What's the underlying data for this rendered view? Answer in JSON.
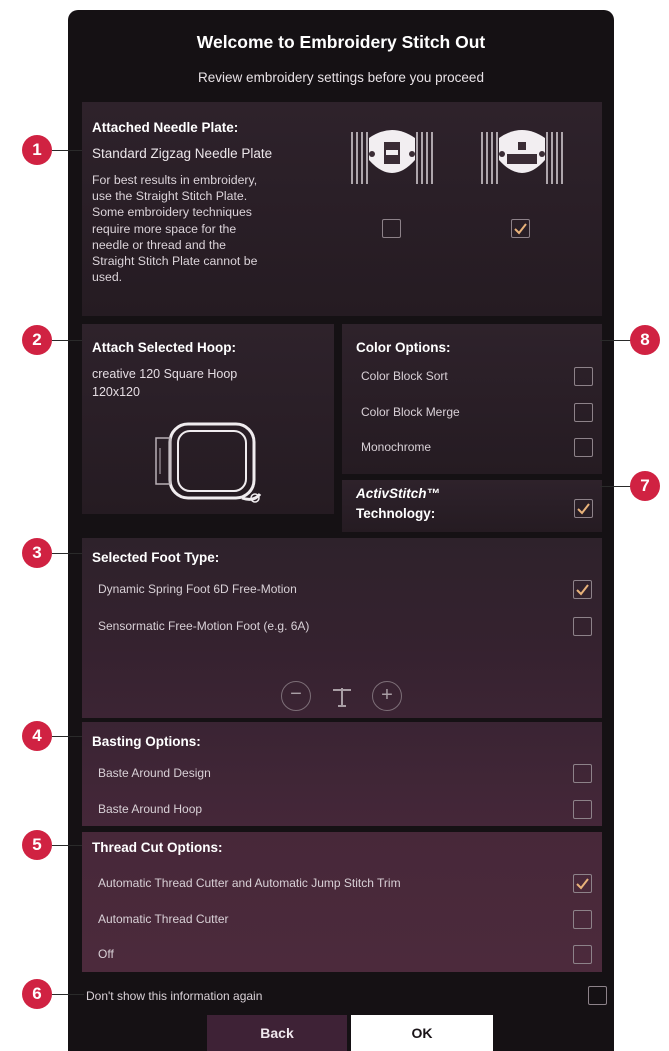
{
  "header": {
    "title": "Welcome to Embroidery Stitch Out",
    "subtitle": "Review embroidery settings before you proceed"
  },
  "needle_plate": {
    "title": "Attached Needle Plate:",
    "value": "Standard Zigzag Needle Plate",
    "desc_lines": [
      "For best results in embroidery,",
      "use the Straight Stitch Plate.",
      "Some embroidery techniques",
      "require more space for the",
      "needle or thread and the",
      "Straight Stitch Plate cannot be",
      "used."
    ],
    "plates": [
      {
        "icon": "zigzag-needle-plate-icon",
        "checked": false
      },
      {
        "icon": "straight-stitch-plate-icon",
        "checked": true
      }
    ]
  },
  "hoop": {
    "title": "Attach Selected Hoop:",
    "name_line1": "creative 120 Square Hoop",
    "name_line2": "120x120"
  },
  "color_options": {
    "title": "Color Options:",
    "items": [
      {
        "label": "Color Block Sort",
        "checked": false
      },
      {
        "label": "Color Block Merge",
        "checked": false
      },
      {
        "label": "Monochrome",
        "checked": false
      }
    ]
  },
  "activstitch": {
    "line1": "ActivStitch™",
    "line2": "Technology:",
    "checked": true
  },
  "foot": {
    "title": "Selected Foot Type:",
    "items": [
      {
        "label": "Dynamic Spring Foot 6D Free-Motion",
        "checked": true
      },
      {
        "label": "Sensormatic Free-Motion Foot (e.g. 6A)",
        "checked": false
      }
    ],
    "minus_symbol": "−",
    "plus_symbol": "+"
  },
  "basting": {
    "title": "Basting Options:",
    "items": [
      {
        "label": "Baste Around Design",
        "checked": false
      },
      {
        "label": "Baste Around Hoop",
        "checked": false
      }
    ]
  },
  "thread_cut": {
    "title": "Thread Cut Options:",
    "items": [
      {
        "label": "Automatic Thread Cutter and Automatic Jump Stitch Trim",
        "checked": true
      },
      {
        "label": "Automatic Thread Cutter",
        "checked": false
      },
      {
        "label": "Off",
        "checked": false
      }
    ]
  },
  "dont_show": {
    "label": "Don't show this information again",
    "checked": false
  },
  "buttons": {
    "back": "Back",
    "ok": "OK"
  },
  "callouts": [
    "1",
    "2",
    "3",
    "4",
    "5",
    "6",
    "7",
    "8"
  ],
  "colors": {
    "background": "#151114",
    "panel": "#2a1f27",
    "callout": "#d02242",
    "check": "#e8b27a",
    "back_button": "#3e2236",
    "ok_button": "#ffffff"
  }
}
